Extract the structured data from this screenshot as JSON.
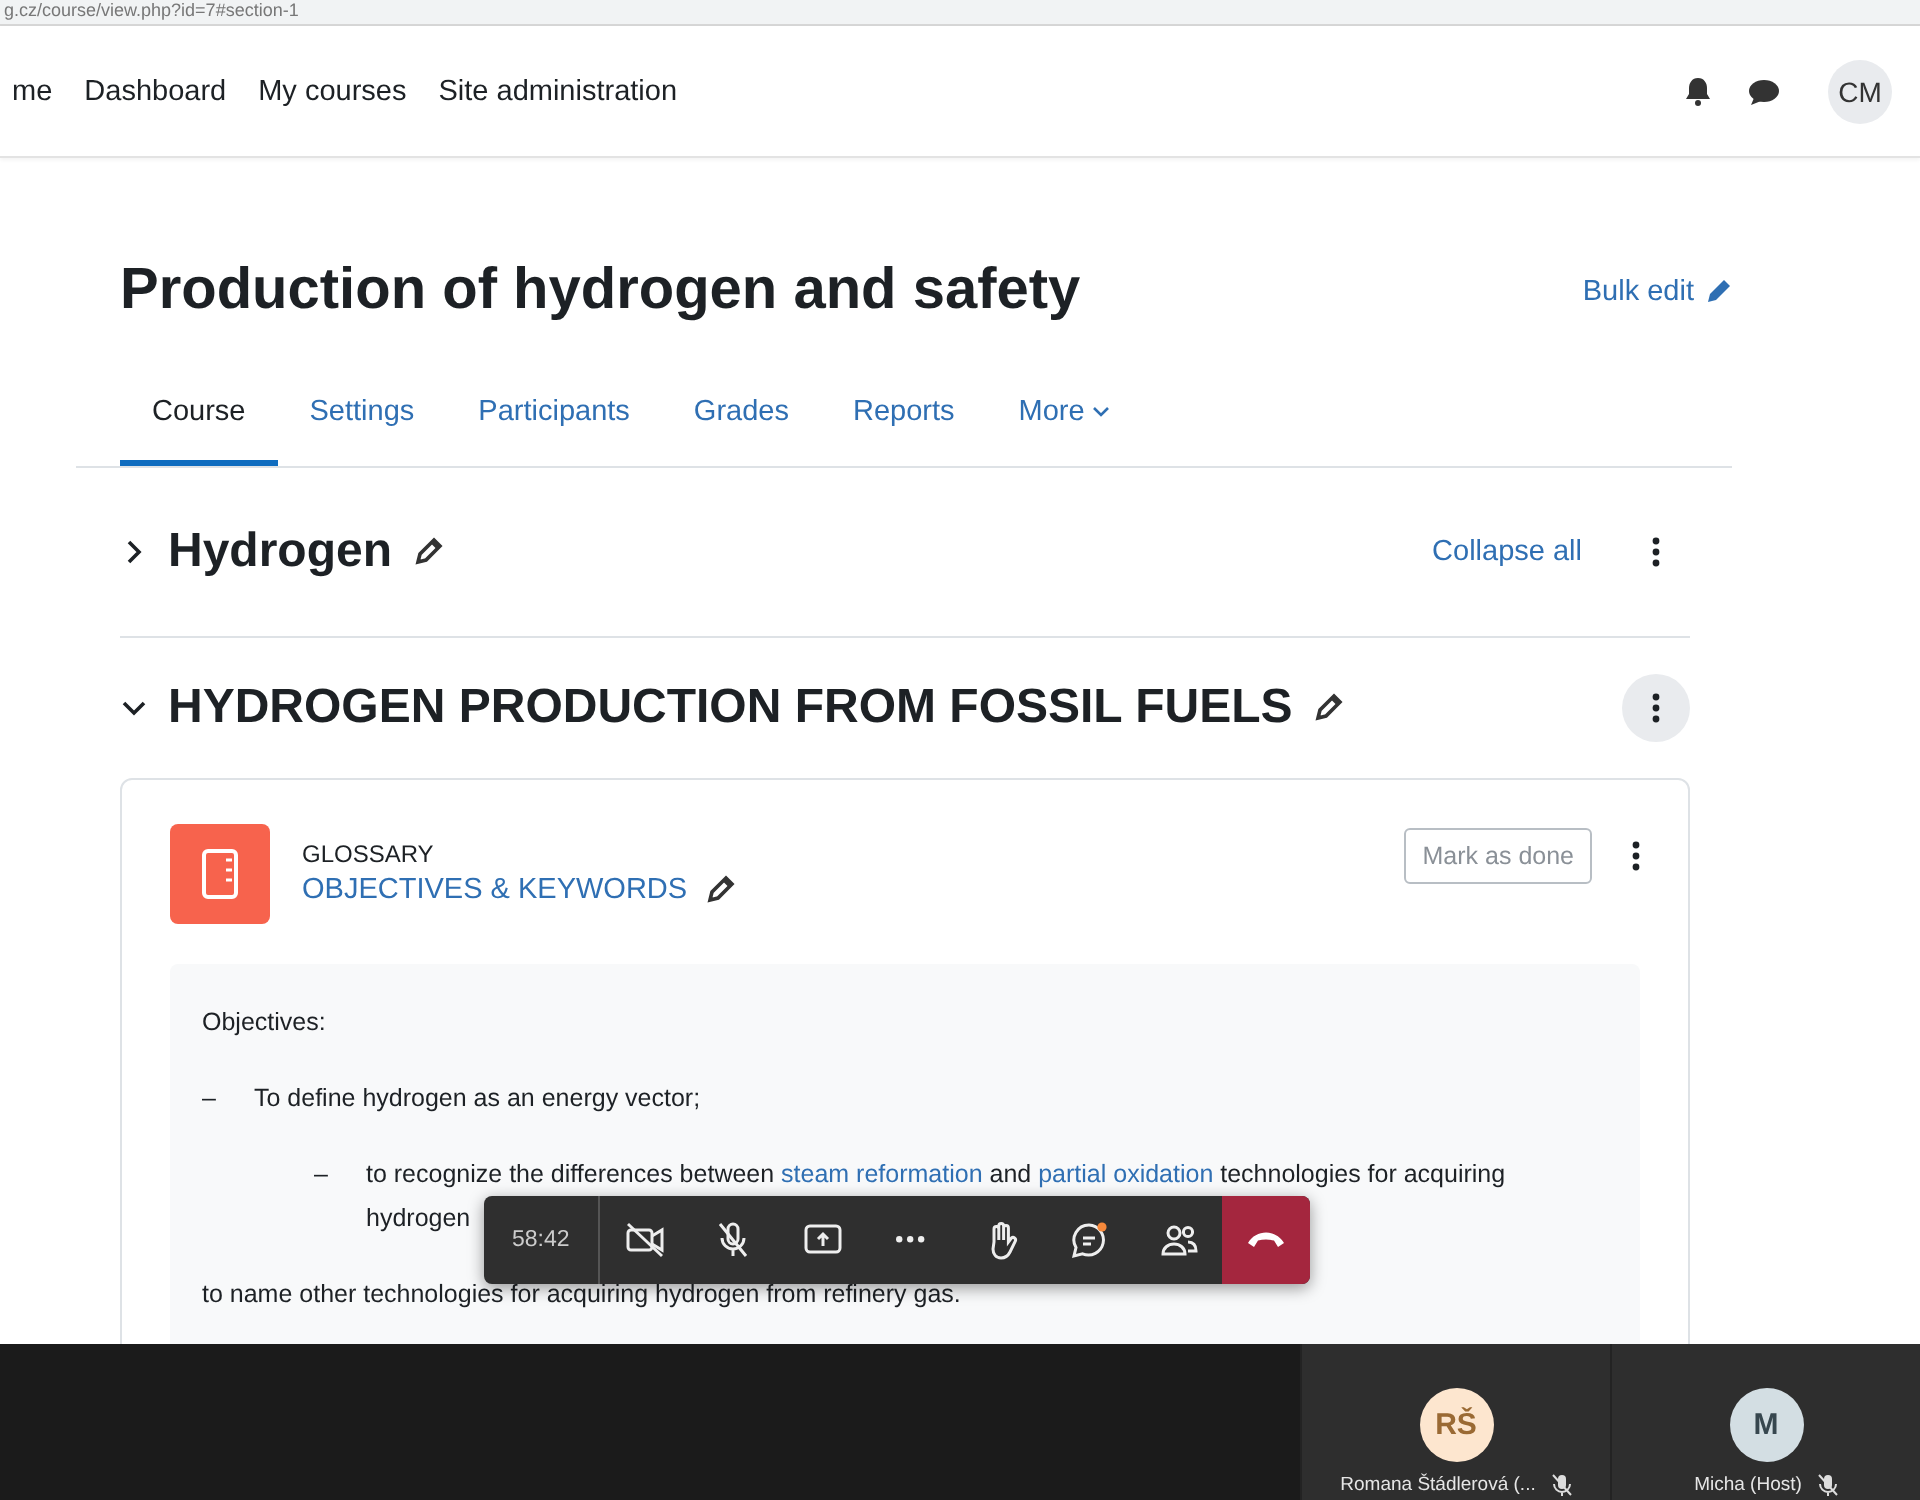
{
  "browser": {
    "url": "g.cz/course/view.php?id=7#section-1"
  },
  "navbar": {
    "links": [
      {
        "label": "me"
      },
      {
        "label": "Dashboard"
      },
      {
        "label": "My courses"
      },
      {
        "label": "Site administration"
      }
    ],
    "avatar": "CM"
  },
  "course": {
    "title": "Production of hydrogen and safety",
    "bulk_edit": "Bulk edit",
    "tabs": [
      {
        "label": "Course",
        "selected": true,
        "kind": "tab"
      },
      {
        "label": "Settings",
        "selected": false,
        "kind": "tab"
      },
      {
        "label": "Participants",
        "selected": false,
        "kind": "tab"
      },
      {
        "label": "Grades",
        "selected": false,
        "kind": "tab"
      },
      {
        "label": "Reports",
        "selected": false,
        "kind": "tab"
      },
      {
        "label": "More",
        "selected": false,
        "kind": "dropdown"
      }
    ]
  },
  "collapse_all": "Collapse all",
  "sections": [
    {
      "title": "Hydrogen",
      "expanded": false
    },
    {
      "title": "HYDROGEN PRODUCTION FROM FOSSIL FUELS",
      "expanded": true,
      "activities": [
        {
          "type": "GLOSSARY",
          "name": "OBJECTIVES & KEYWORDS",
          "button": "Mark as done",
          "description": [
            {
              "kind": "plain",
              "parts": [
                {
                  "text": "Objectives:"
                }
              ]
            },
            {
              "kind": "bullet",
              "marker": "–",
              "parts": [
                {
                  "text": "To define hydrogen as an energy vector;"
                }
              ]
            },
            {
              "kind": "subbullet",
              "marker": "–",
              "parts": [
                {
                  "text": "to recognize the differences between "
                },
                {
                  "text": "steam reformation",
                  "link": true
                },
                {
                  "text": " and "
                },
                {
                  "text": "partial oxidation",
                  "link": true
                },
                {
                  "text": " technologies for acquiring hydrogen"
                }
              ]
            },
            {
              "kind": "plain",
              "parts": [
                {
                  "text": "to name other technologies for acquiring hydrogen from refinery gas."
                }
              ]
            }
          ]
        }
      ]
    }
  ],
  "call": {
    "timer": "58:42",
    "participants": [
      {
        "initials": "RŠ",
        "name": "Romana Štádlerová (...",
        "color": "#fde6cf",
        "muted": true
      },
      {
        "initials": "M",
        "name": "Micha (Host)",
        "color": "#d3dee3",
        "muted": true
      }
    ]
  }
}
